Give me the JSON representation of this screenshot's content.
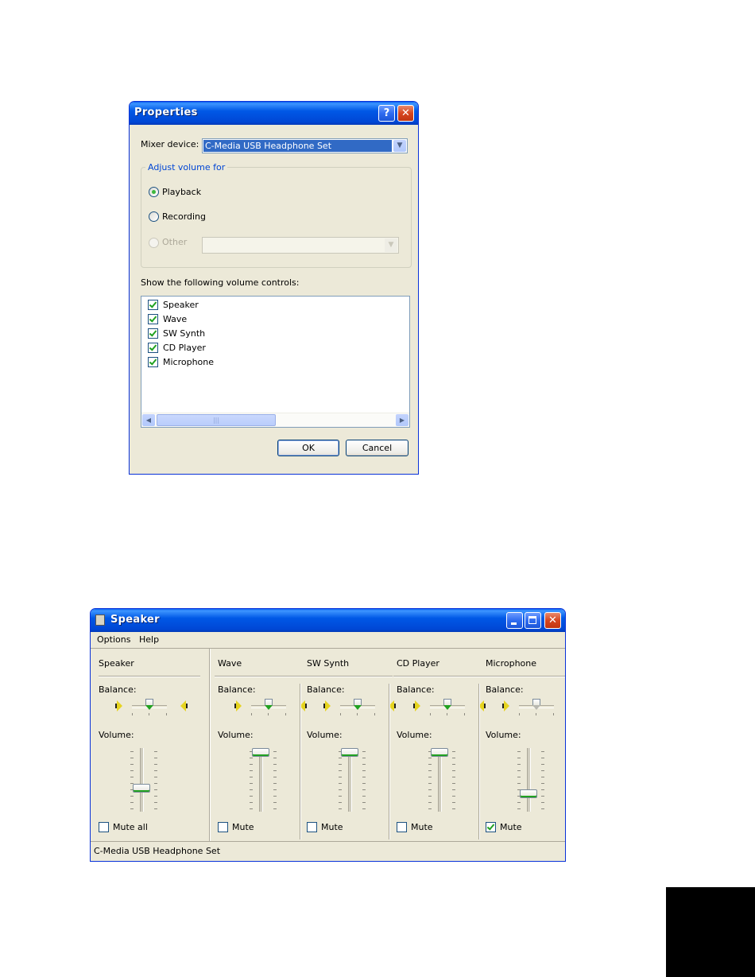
{
  "properties": {
    "title": "Properties",
    "help_glyph": "?",
    "close_glyph": "✕",
    "mixer_device_label": "Mixer device:",
    "mixer_device_value": "C-Media USB Headphone Set",
    "adjust_group_label": "Adjust volume for",
    "radio_playback": "Playback",
    "radio_recording": "Recording",
    "radio_other": "Other",
    "selected_radio": "Playback",
    "controls_label": "Show the following volume controls:",
    "controls": [
      {
        "label": "Speaker",
        "checked": true
      },
      {
        "label": "Wave",
        "checked": true
      },
      {
        "label": "SW Synth",
        "checked": true
      },
      {
        "label": "CD Player",
        "checked": true
      },
      {
        "label": "Microphone",
        "checked": true
      }
    ],
    "ok_label": "OK",
    "cancel_label": "Cancel"
  },
  "mixer": {
    "title": "Speaker",
    "menu": [
      "Options",
      "Help"
    ],
    "balance_label": "Balance:",
    "volume_label": "Volume:",
    "channels": [
      {
        "name": "Speaker",
        "mute_label": "Mute all",
        "muted": false,
        "volume": 0.35,
        "balance": 0.5
      },
      {
        "name": "Wave",
        "mute_label": "Mute",
        "muted": false,
        "volume": 1.0,
        "balance": 0.5
      },
      {
        "name": "SW Synth",
        "mute_label": "Mute",
        "muted": false,
        "volume": 1.0,
        "balance": 0.5
      },
      {
        "name": "CD Player",
        "mute_label": "Mute",
        "muted": false,
        "volume": 1.0,
        "balance": 0.5
      },
      {
        "name": "Microphone",
        "mute_label": "Mute",
        "muted": true,
        "volume": 0.25,
        "balance": 0.5
      }
    ],
    "status_text": "C-Media USB Headphone Set"
  },
  "colors": {
    "title_bar": "#0058e6",
    "face": "#ece9d8",
    "check": "#21a121",
    "group_label": "#0046d5"
  }
}
